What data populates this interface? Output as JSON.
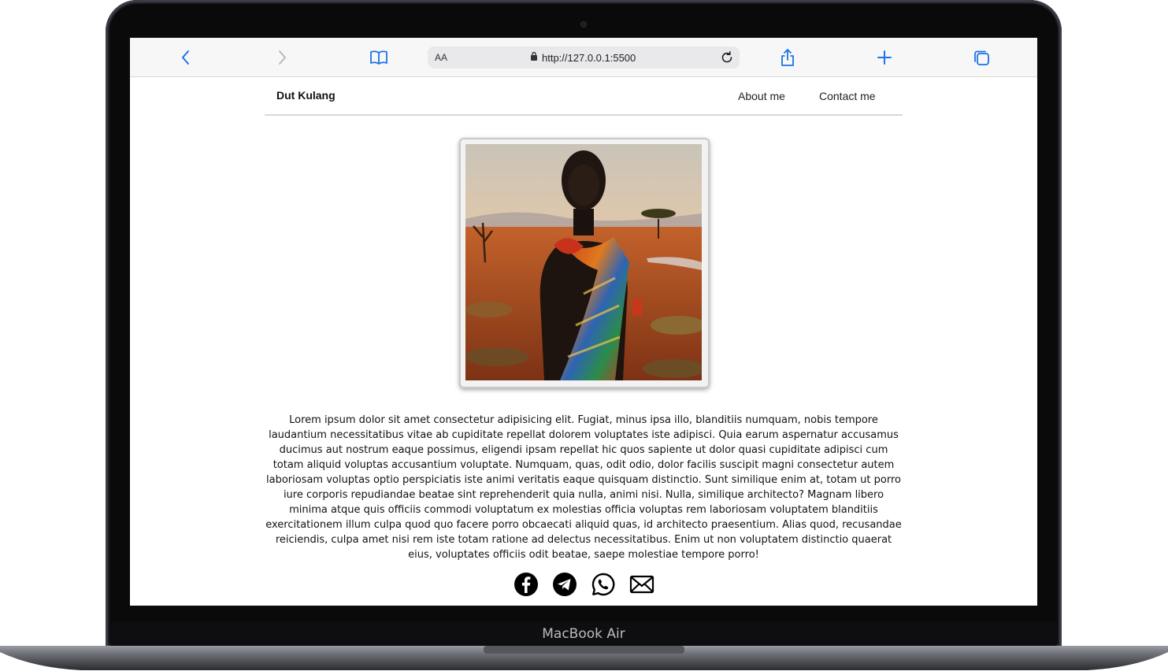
{
  "device": {
    "label": "MacBook Air"
  },
  "browser": {
    "text_size_label": "AA",
    "url": "http://127.0.0.1:5500",
    "icons": [
      "back-chevron-icon",
      "forward-chevron-icon",
      "bookmarks-book-icon",
      "lock-icon",
      "reload-icon",
      "share-icon",
      "new-tab-plus-icon",
      "tabs-overview-icon"
    ]
  },
  "site": {
    "brand": "Dut Kulang",
    "nav": [
      "About me",
      "Contact me"
    ],
    "profile_photo": {
      "subject": "portrait of a man in colorful wrap in savanna landscape"
    },
    "bio": "Lorem ipsum dolor sit amet consectetur adipisicing elit. Fugiat, minus ipsa illo, blanditiis numquam, nobis tempore laudantium necessitatibus vitae ab cupiditate repellat dolorem voluptates iste adipisci. Quia earum aspernatur accusamus ducimus aut nostrum eaque possimus, eligendi ipsam repellat hic quos sapiente ut dolor quasi cupiditate adipisci cum totam aliquid voluptas accusantium voluptate. Numquam, quas, odit odio, dolor facilis suscipit magni consectetur autem laboriosam voluptas optio perspiciatis iste animi veritatis eaque quisquam distinctio. Sunt similique enim at, totam ut porro iure corporis repudiandae beatae sint reprehenderit quia nulla, animi nisi. Nulla, similique architecto? Magnam libero minima atque quis officiis commodi voluptatum ex molestias officia voluptas rem laboriosam voluptatem blanditiis exercitationem illum culpa quod quo facere porro obcaecati aliquid quas, id architecto praesentium. Alias quod, recusandae reiciendis, culpa amet nisi rem iste totam ratione ad delectus necessitatibus. Enim ut non voluptatem distinctio quaerat eius, voluptates officiis odit beatae, saepe molestiae tempore porro!",
    "social_icons": [
      "facebook-icon",
      "telegram-icon",
      "whatsapp-icon",
      "email-icon"
    ]
  },
  "colors": {
    "accent": "#1a73e8",
    "text": "#111111",
    "divider": "#d8d8d8"
  }
}
